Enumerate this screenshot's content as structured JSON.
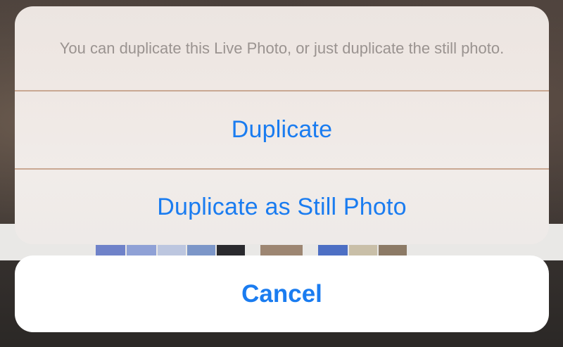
{
  "action_sheet": {
    "message": "You can duplicate this Live Photo, or just duplicate the still photo.",
    "actions": [
      {
        "label": "Duplicate"
      },
      {
        "label": "Duplicate as Still Photo"
      }
    ],
    "cancel_label": "Cancel"
  },
  "colors": {
    "action_blue": "#1a7cf0",
    "message_gray": "#9a9390",
    "divider": "#c9a892"
  }
}
